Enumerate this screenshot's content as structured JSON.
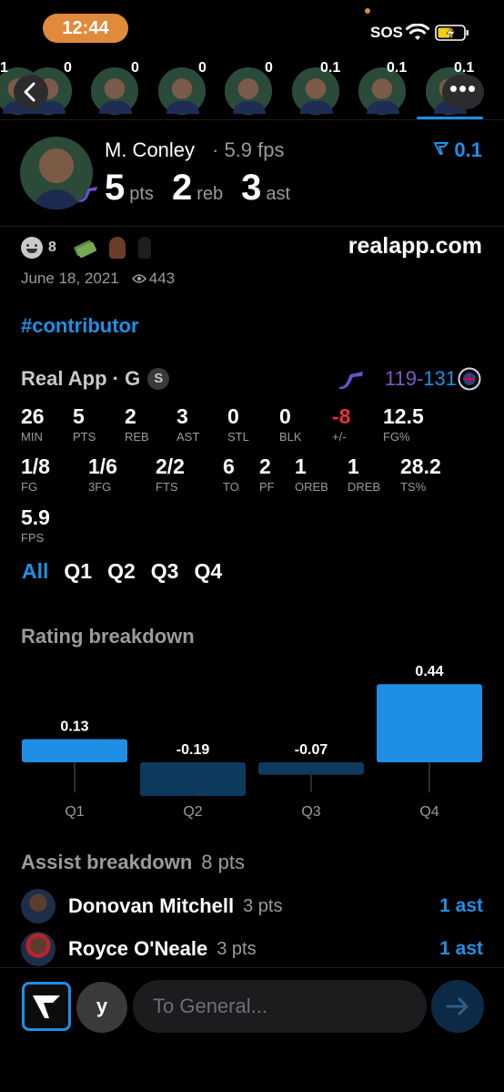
{
  "status_bar": {
    "time": "12:44",
    "sos": "SOS",
    "accent_color": "#e08a3c"
  },
  "player_strip": {
    "values": [
      "1",
      "0",
      "0",
      "0",
      "0",
      "0.1",
      "0.1",
      "0.1"
    ],
    "more_label": "•••"
  },
  "player": {
    "name": "M. Conley",
    "fps": "· 5.9 fps",
    "rating": "0.1",
    "stats": [
      {
        "value": "5",
        "label": "pts"
      },
      {
        "value": "2",
        "label": "reb"
      },
      {
        "value": "3",
        "label": "ast"
      }
    ]
  },
  "reactions": {
    "emoji_count": "8",
    "domain": "realapp.com",
    "date": "June 18, 2021",
    "views": "443"
  },
  "hashtag": "#contributor",
  "game": {
    "title": "Real App · G",
    "badge": "S",
    "score_a": "119",
    "score_dash": "-",
    "score_b": "131",
    "stats": [
      {
        "value": "26",
        "label": "MIN"
      },
      {
        "value": "5",
        "label": "PTS"
      },
      {
        "value": "2",
        "label": "REB"
      },
      {
        "value": "3",
        "label": "AST"
      },
      {
        "value": "0",
        "label": "STL"
      },
      {
        "value": "0",
        "label": "BLK"
      },
      {
        "value": "-8",
        "label": "+/-"
      },
      {
        "value": "12.5",
        "label": "FG%"
      },
      {
        "value": "1/8",
        "label": "FG"
      },
      {
        "value": "1/6",
        "label": "3FG"
      },
      {
        "value": "2/2",
        "label": "FTS"
      },
      {
        "value": "6",
        "label": "TO"
      },
      {
        "value": "2",
        "label": "PF"
      },
      {
        "value": "1",
        "label": "OREB"
      },
      {
        "value": "1",
        "label": "DREB"
      },
      {
        "value": "28.2",
        "label": "TS%"
      },
      {
        "value": "5.9",
        "label": "FPS"
      }
    ]
  },
  "quarter_tabs": [
    "All",
    "Q1",
    "Q2",
    "Q3",
    "Q4"
  ],
  "rating_breakdown": {
    "title": "Rating breakdown"
  },
  "chart_data": {
    "type": "bar",
    "categories": [
      "Q1",
      "Q2",
      "Q3",
      "Q4"
    ],
    "values": [
      0.13,
      -0.19,
      -0.07,
      0.44
    ],
    "value_labels": [
      "0.13",
      "-0.19",
      "-0.07",
      "0.44"
    ],
    "positive_color": "#1f8fe5",
    "negative_color": "#0e3a60"
  },
  "assist_breakdown": {
    "title": "Assist breakdown",
    "points": "8 pts",
    "rows": [
      {
        "name": "Donovan Mitchell",
        "pts": "3 pts",
        "ast": "1 ast"
      },
      {
        "name": "Royce O'Neale",
        "pts": "3 pts",
        "ast": "1 ast"
      }
    ]
  },
  "composer": {
    "user_initial": "y",
    "placeholder": "To General..."
  }
}
